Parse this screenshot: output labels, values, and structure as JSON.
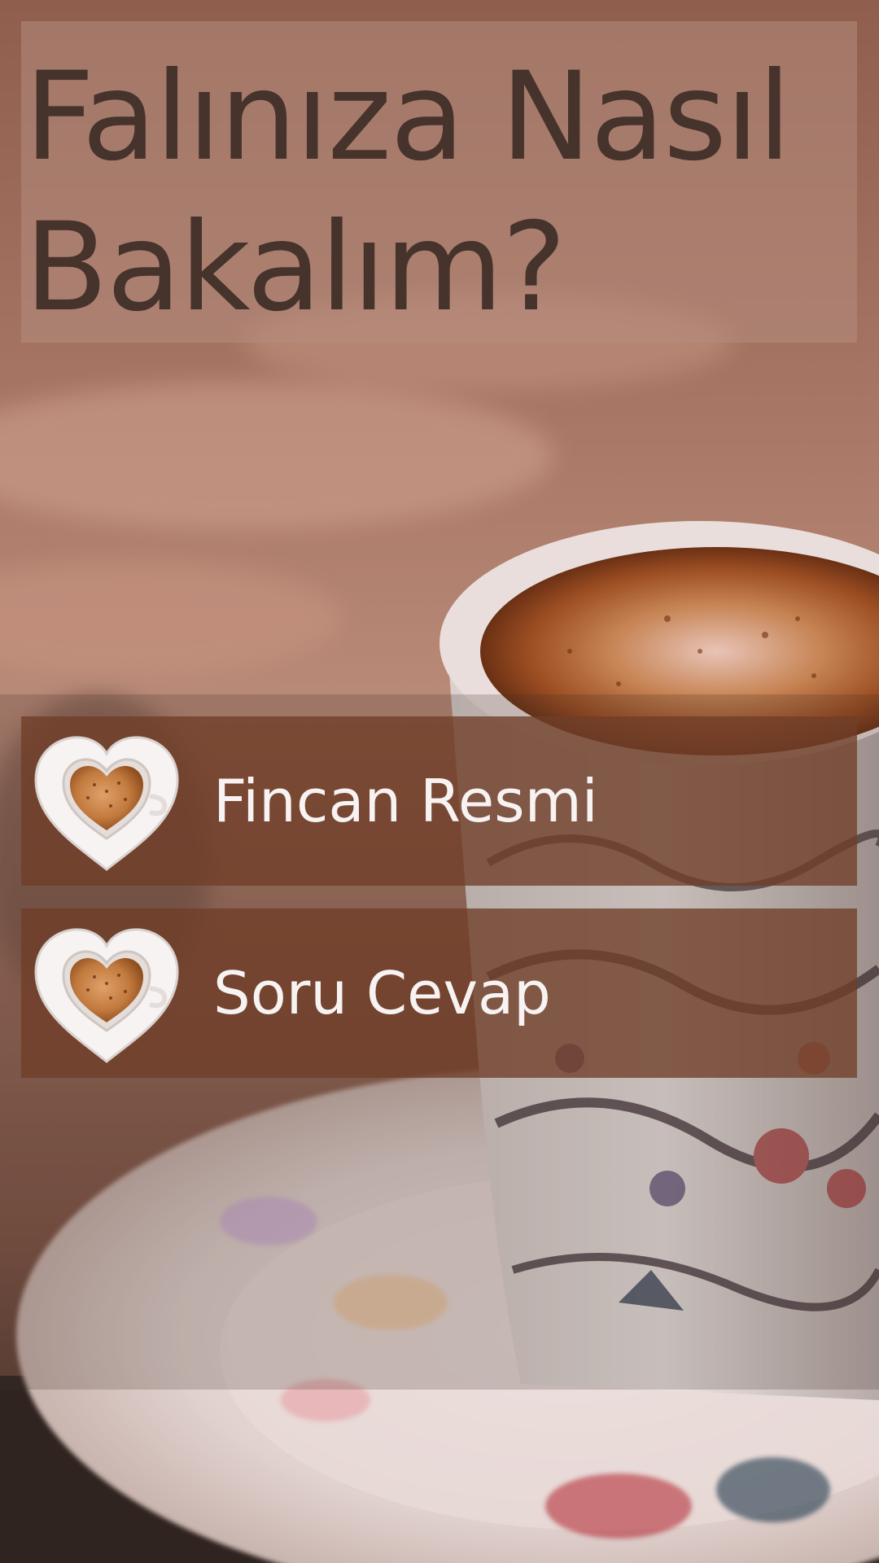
{
  "title": "Falınıza Nasıl Bakalım?",
  "menu": [
    {
      "label": "Fincan Resmi",
      "icon": "heart-coffee-cup-icon"
    },
    {
      "label": "Soru Cevap",
      "icon": "heart-coffee-cup-icon"
    }
  ],
  "colors": {
    "title_text": "#46332c",
    "menu_item_bg": "#703e28",
    "menu_label": "#f7f3f2"
  }
}
